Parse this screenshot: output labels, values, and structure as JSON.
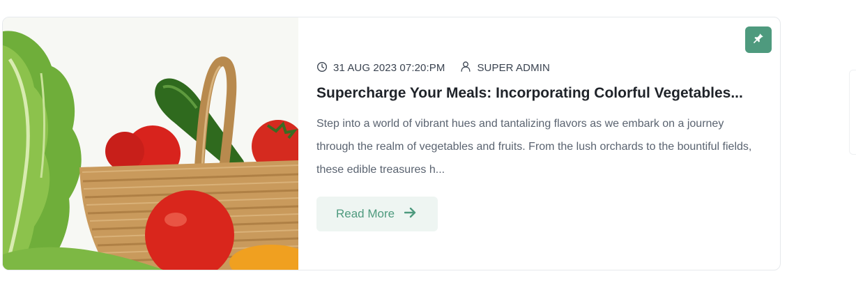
{
  "post": {
    "date": "31 AUG 2023 07:20:PM",
    "author": "SUPER ADMIN",
    "title": "Supercharge Your Meals: Incorporating Colorful Vegetables...",
    "excerpt": "Step into a world of vibrant hues and tantalizing flavors as we embark on a journey through the realm of vegetables and fruits. From the lush orchards to the bountiful fields, these edible treasures h...",
    "read_more_label": "Read More",
    "image_subject": "vegetables-basket",
    "pinned": true
  },
  "icons": {
    "date": "clock-icon",
    "author": "user-icon",
    "pin": "pin-icon",
    "read_more": "arrow-right-icon"
  },
  "colors": {
    "accent": "#4e9a7e",
    "accent_light": "#eef5f2",
    "title": "#1f2329",
    "text": "#5a6370",
    "border": "#e6e9ec"
  }
}
